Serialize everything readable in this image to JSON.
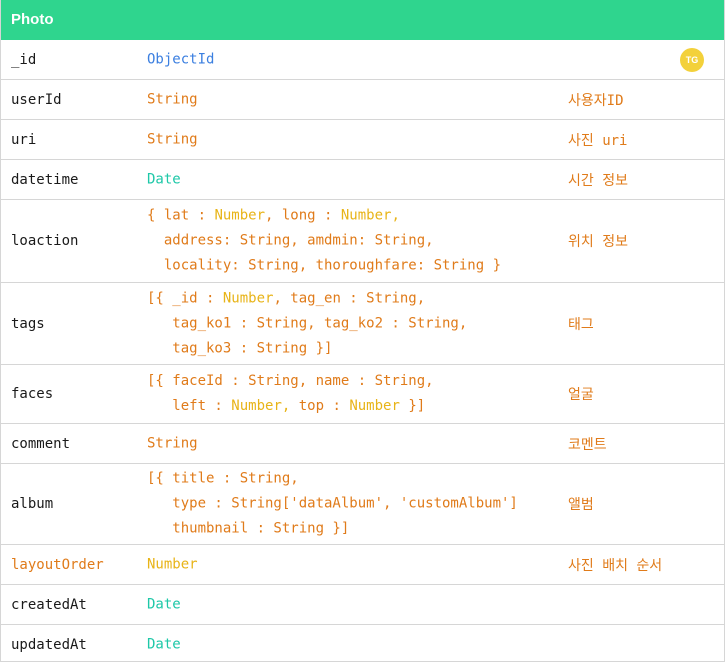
{
  "table": {
    "title": "Photo",
    "badge": "TG",
    "rows": [
      {
        "name": "_id",
        "lines": [
          [
            [
              "ObjectId",
              "blue"
            ]
          ]
        ],
        "desc": ""
      },
      {
        "name": "userId",
        "lines": [
          [
            [
              "String",
              "orange"
            ]
          ]
        ],
        "desc": "사용자ID"
      },
      {
        "name": "uri",
        "lines": [
          [
            [
              "String",
              "orange"
            ]
          ]
        ],
        "desc": "사진 uri"
      },
      {
        "name": "datetime",
        "lines": [
          [
            [
              "Date",
              "teal"
            ]
          ]
        ],
        "desc": "시간 정보"
      },
      {
        "name": "loaction",
        "lines": [
          [
            [
              "{ lat : ",
              "orange"
            ],
            [
              "Number",
              "yellow"
            ],
            [
              ", long : ",
              "orange"
            ],
            [
              "Number,",
              "yellow"
            ]
          ],
          [
            [
              "  address: String, amdmin: String,",
              "orange"
            ]
          ],
          [
            [
              "  locality: String, thoroughfare: String }",
              "orange"
            ]
          ]
        ],
        "desc": "위치 정보"
      },
      {
        "name": "tags",
        "lines": [
          [
            [
              "[{ _id : ",
              "orange"
            ],
            [
              "Number",
              "yellow"
            ],
            [
              ", tag_en : String,",
              "orange"
            ]
          ],
          [
            [
              "   tag_ko1 : String, tag_ko2 : String,",
              "orange"
            ]
          ],
          [
            [
              "   tag_ko3 : String }]",
              "orange"
            ]
          ]
        ],
        "desc": "태그"
      },
      {
        "name": "faces",
        "lines": [
          [
            [
              "[{ faceId : String, name : String,",
              "orange"
            ]
          ],
          [
            [
              "   left : ",
              "orange"
            ],
            [
              "Number, ",
              "yellow"
            ],
            [
              "top : ",
              "orange"
            ],
            [
              "Number",
              "yellow"
            ],
            [
              " }]",
              "orange"
            ]
          ]
        ],
        "desc": "얼굴"
      },
      {
        "name": "comment",
        "lines": [
          [
            [
              "String",
              "orange"
            ]
          ]
        ],
        "desc": "코멘트"
      },
      {
        "name": "album",
        "lines": [
          [
            [
              "[{ title : String,",
              "orange"
            ]
          ],
          [
            [
              "   type : String['dataAlbum', 'customAlbum']",
              "orange"
            ]
          ],
          [
            [
              "   thumbnail : String }]",
              "orange"
            ]
          ]
        ],
        "desc": "앨범"
      },
      {
        "name": "layoutOrder",
        "name_color": "orange",
        "lines": [
          [
            [
              "Number",
              "yellow"
            ]
          ]
        ],
        "desc": "사진 배치 순서"
      },
      {
        "name": "createdAt",
        "lines": [
          [
            [
              "Date",
              "teal"
            ]
          ]
        ],
        "desc": ""
      },
      {
        "name": "updatedAt",
        "lines": [
          [
            [
              "Date",
              "teal"
            ]
          ]
        ],
        "desc": ""
      }
    ]
  }
}
